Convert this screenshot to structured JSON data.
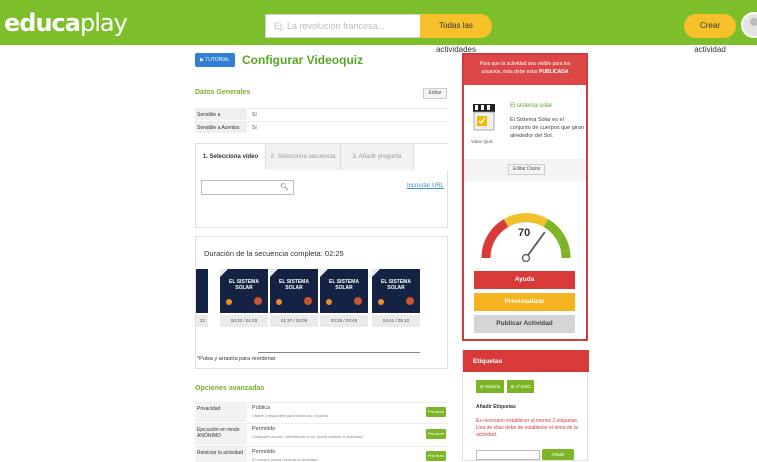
{
  "header": {
    "logo_bold": "educa",
    "logo_light": "play",
    "search_placeholder": "Ej. La revolución francesa...",
    "search_button": "Todas las actividades",
    "create_button": "Crear actividad"
  },
  "page": {
    "tutorial_label": "TUTORIAL",
    "title": "Configurar Videoquiz"
  },
  "general": {
    "title": "Datos Generales",
    "edit_label": "Editar",
    "rows": [
      {
        "key": "Sensible a Mayúsculas",
        "value": "Sí"
      },
      {
        "key": "Sensible a Acentos",
        "value": "Sí"
      }
    ]
  },
  "tabs": [
    {
      "label": "1. Selecciona vídeo"
    },
    {
      "label": "2. Selecciona secuencia"
    },
    {
      "label": "3. Añadir pregunta"
    }
  ],
  "video_search": {
    "placeholder": "",
    "import_link": "Incrustar URL"
  },
  "sequence": {
    "title": "Duración de la secuencia completa: 02:25",
    "thumb_text": "EL SISTEMA SOLAR",
    "thumb_text_partial": "A",
    "timestamps": [
      "22",
      "00:32 / 01:03",
      "01:37 / 02:09",
      "03:28 / 03:49",
      "04:41 / 05:10"
    ],
    "note": "*Pulsa y arrastra para reordenar"
  },
  "advanced": {
    "title": "Opciones avanzadas",
    "premium_label": "Premium",
    "rows": [
      {
        "key": "Privacidad",
        "value": "Pública",
        "desc": "Visible y disponible para todos los usuarios"
      },
      {
        "key": "Ejecución en modo ANÓNIMO",
        "value": "Permitido",
        "desc": "Cualquier usuario, identificado o no, podrá realizar la actividad"
      },
      {
        "key": "Reiniciar la actividad",
        "value": "Permitido",
        "desc": "El usuario podrá reiniciar la actividad"
      }
    ]
  },
  "publish_panel": {
    "notice_line1": "Para que la actividad sea visible para los",
    "notice_line2": "usuarios, ésta debe estar",
    "notice_bold": "PUBLICADA",
    "activity_title": "El sistema solar",
    "activity_desc": "El Sistema Solar es el conjunto de cuerpos que giran alrededor del Sol.",
    "icon_label": "Video Quiz",
    "edit_data": "Editar Datos",
    "gauge_value": "70",
    "gauge_fraction": 0.7,
    "help_button": "Ayuda",
    "preview_button": "Previsualizar",
    "publish_button": "Publicar Actividad"
  },
  "tags_panel": {
    "title": "Etiquetas",
    "history_button": "Historia",
    "level_button": "1º ESO",
    "add_title": "Añadir Etiquetas",
    "warning": "Es necesario establecer al menos 3 etiquetas. Una de ellas debe de establecer el tema de la actividad.",
    "add_button": "Añadir"
  },
  "colors": {
    "brand_green": "#7cbf2a",
    "accent_yellow": "#f6c02b",
    "red": "#d23b3b",
    "link_blue": "#3c8fd8"
  }
}
